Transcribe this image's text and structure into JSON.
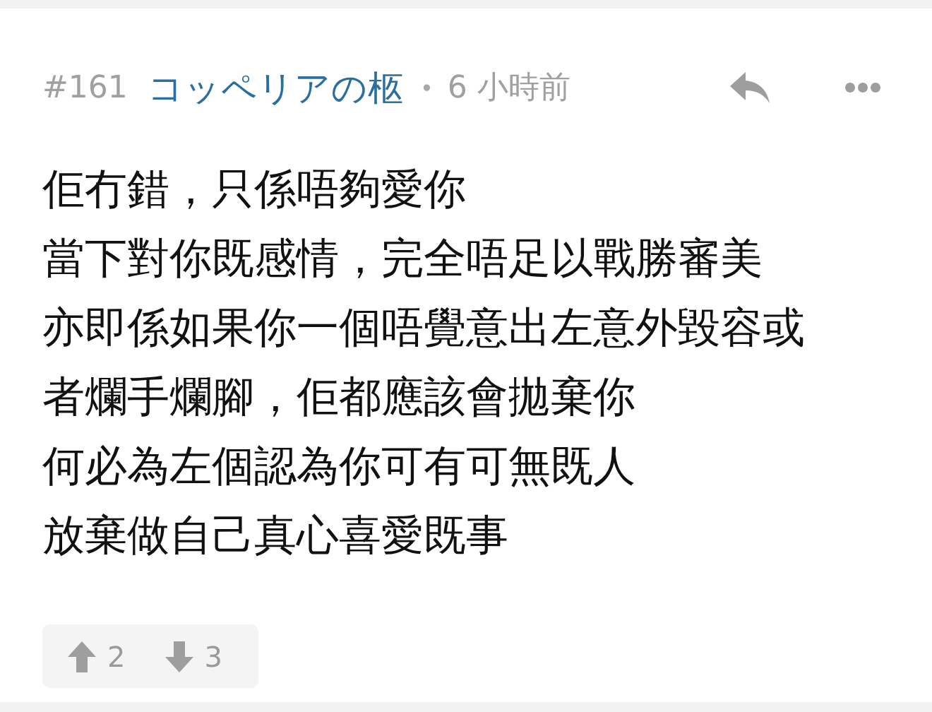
{
  "post": {
    "number": "#161",
    "author": "コッペリアの柩",
    "separator": "•",
    "time": "6 小時前"
  },
  "body": [
    "佢冇錯，只係唔夠愛你",
    "當下對你既感情，完全唔足以戰勝審美",
    "亦即係如果你一個唔覺意出左意外毀容或",
    "者爛手爛腳，佢都應該會拋棄你",
    "何必為左個認為你可有可無既人",
    "放棄做自己真心喜愛既事"
  ],
  "votes": {
    "up": "2",
    "down": "3"
  }
}
